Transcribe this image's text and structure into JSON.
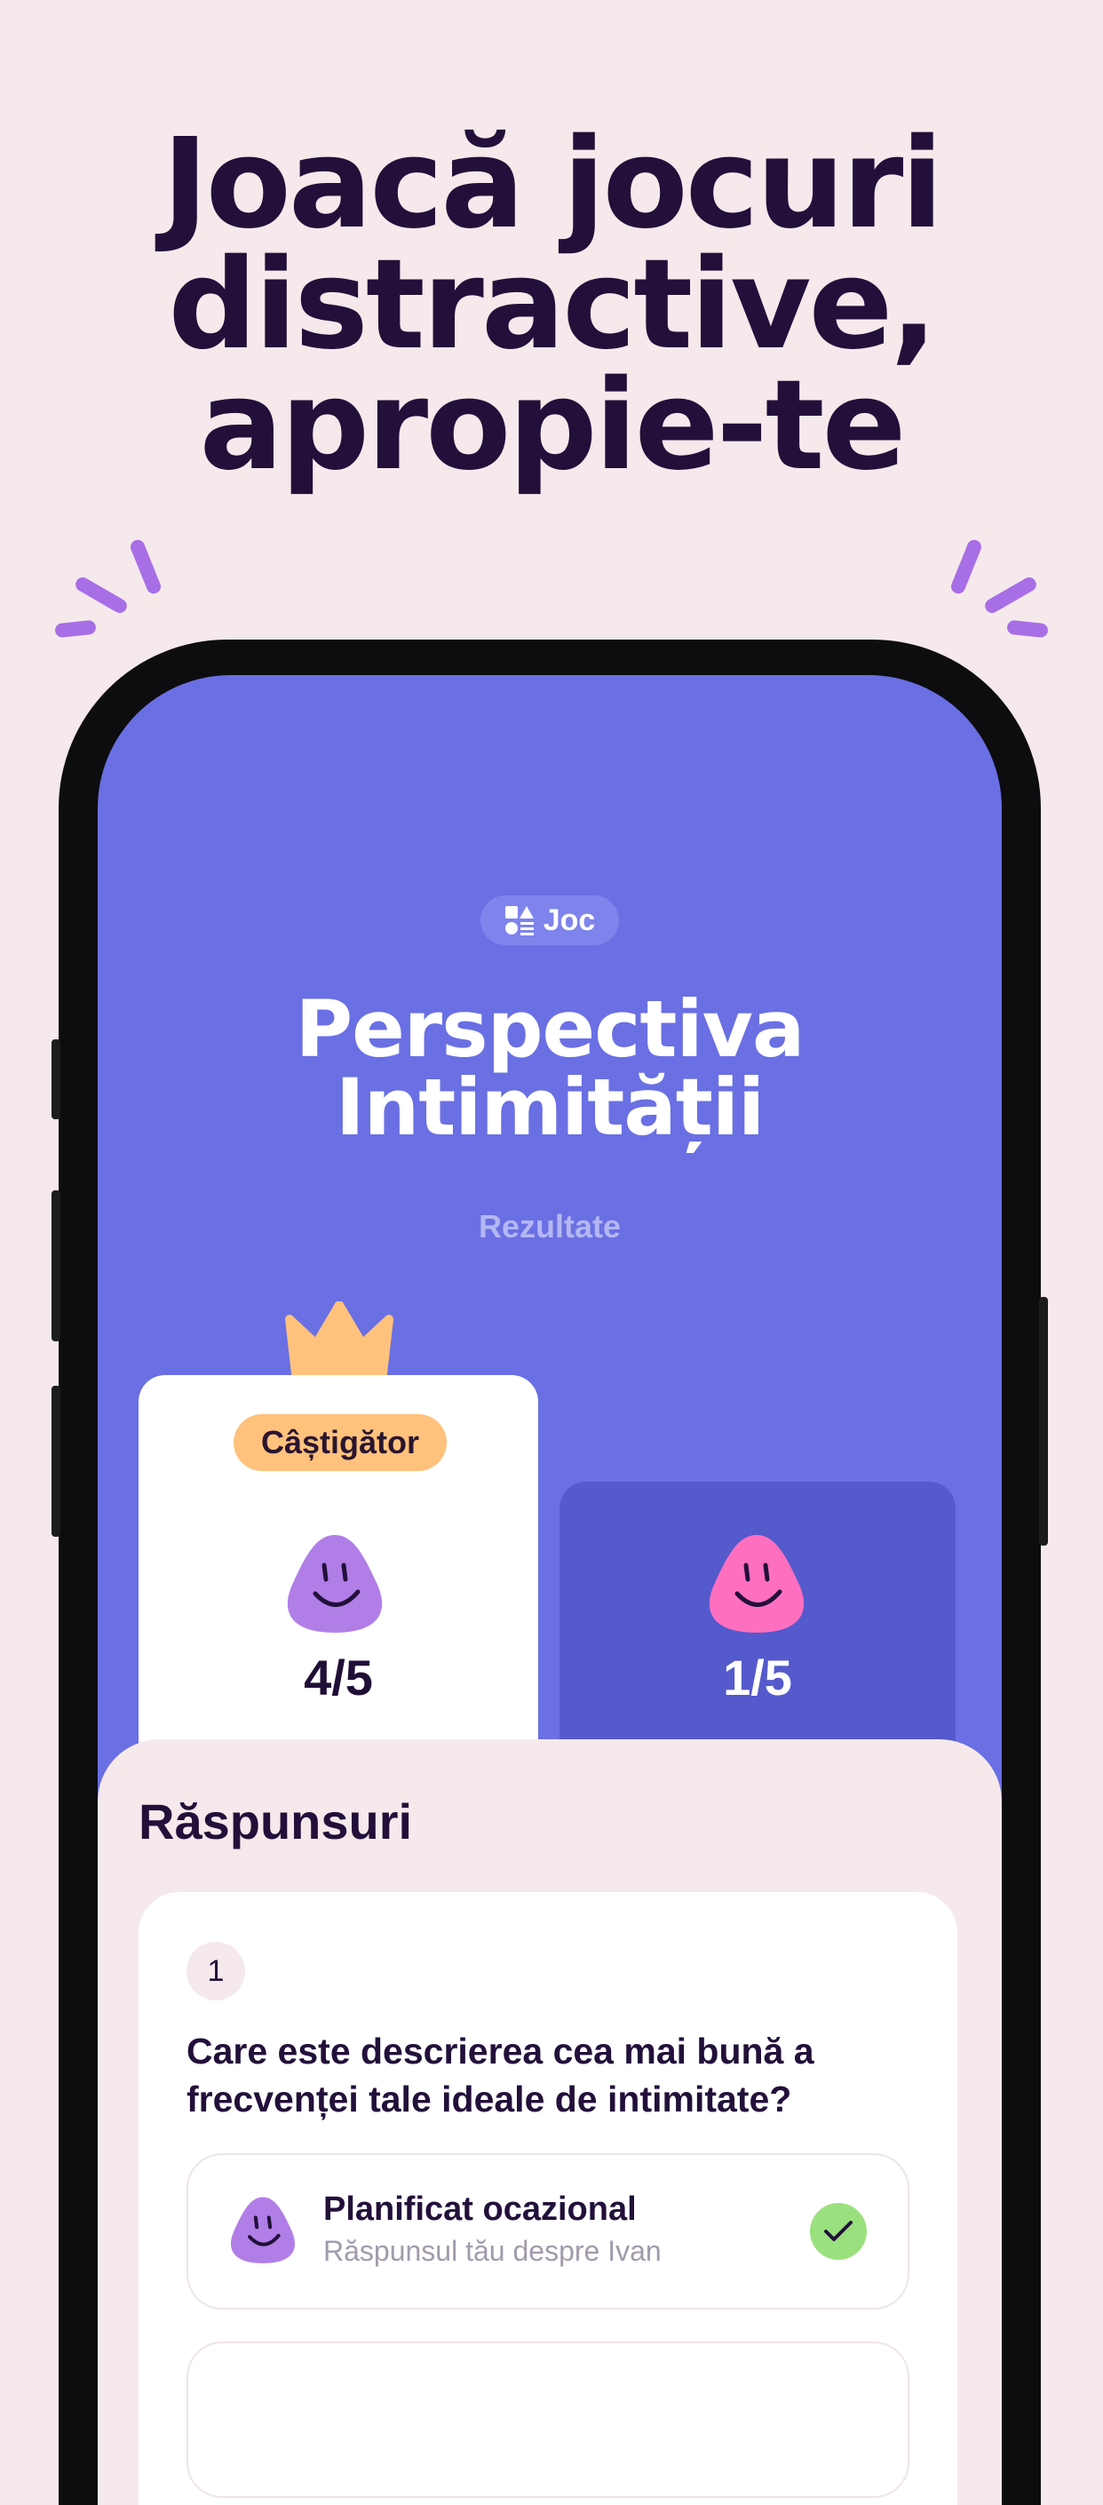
{
  "headline": {
    "line1": "Joacă jocuri",
    "line2": "distractive,",
    "line3": "apropie-te"
  },
  "colors": {
    "background": "#f5e9ec",
    "screen": "#6a6fe3",
    "accent_purple": "#a86ee6",
    "winner_badge": "#ffc27c",
    "check_green": "#9be07f",
    "pink_avatar": "#ff6fbf",
    "purple_avatar": "#b17ee8"
  },
  "screen": {
    "pill_label": "Joc",
    "pill_icon": "game-shapes-icon",
    "title_line1": "Perspectiva",
    "title_line2": "Intimității",
    "subtitle": "Rezultate"
  },
  "players": [
    {
      "badge": "Câștigător",
      "score": "4/5",
      "avatar": "purple-blob-face-icon"
    },
    {
      "score": "1/5",
      "avatar": "pink-blob-face-icon"
    }
  ],
  "answers": {
    "title": "Răspunsuri",
    "question_number": "1",
    "question": "Care este descrierea cea mai bună a frecvenței tale ideale de intimitate?",
    "options": [
      {
        "label": "Planificat ocazional",
        "sub": "Răspunsul tău despre Ivan",
        "correct": true
      }
    ]
  }
}
